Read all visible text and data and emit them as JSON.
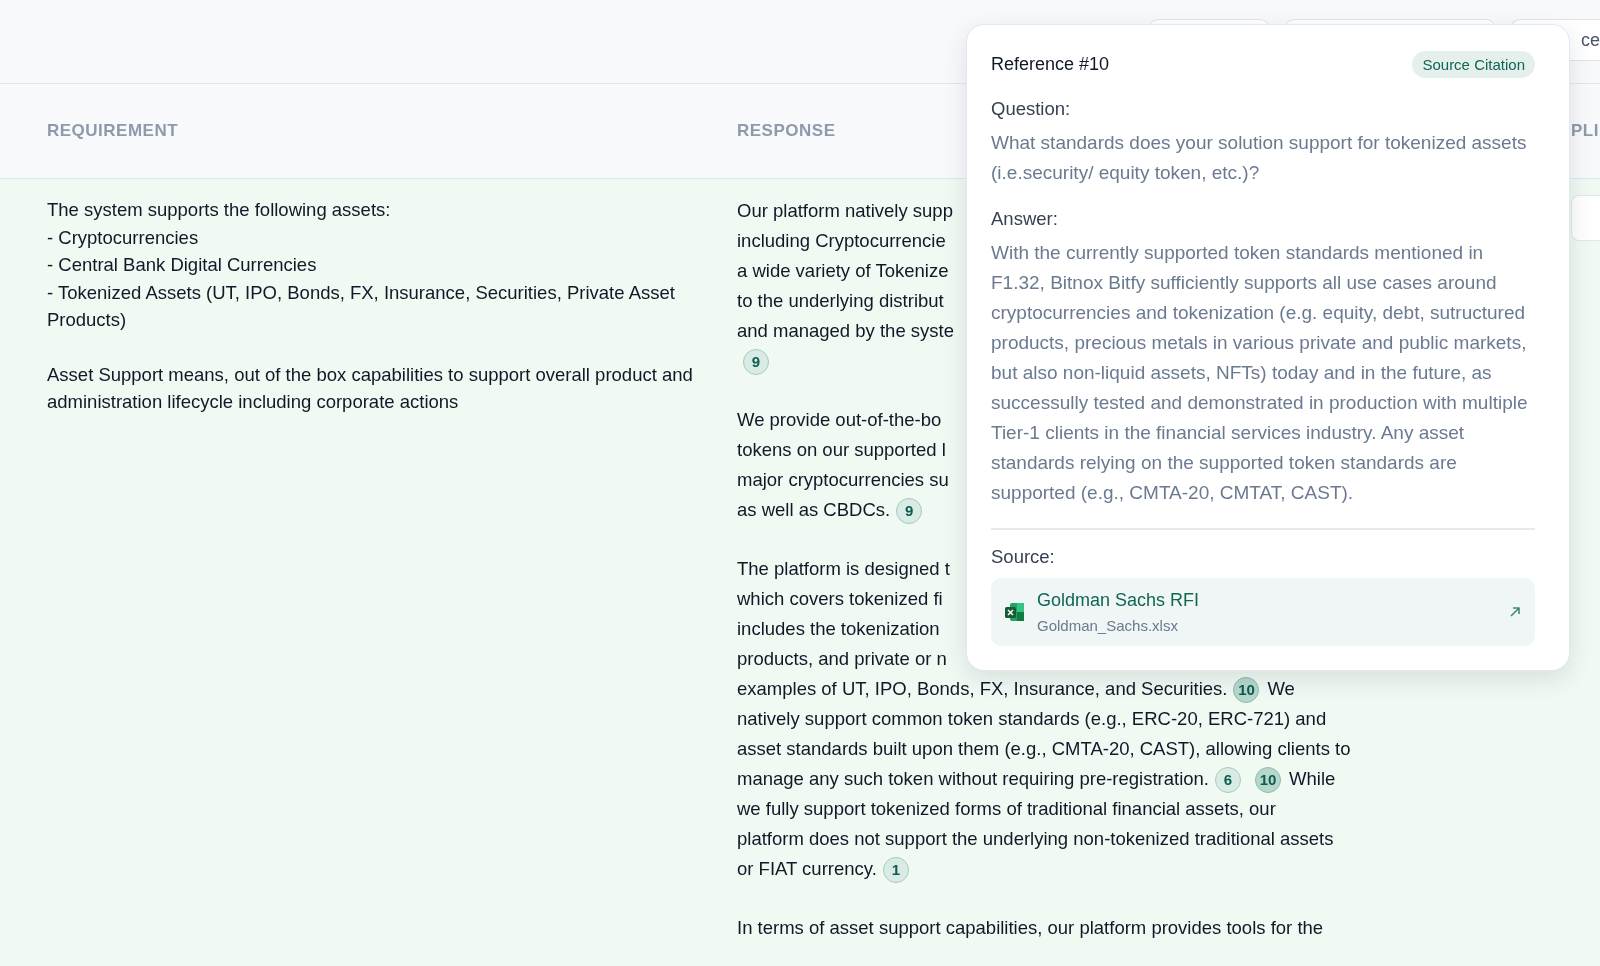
{
  "toolbar": [
    {
      "kind": "blank"
    },
    {
      "kind": "blank"
    },
    {
      "kind": "text",
      "label": "ce"
    }
  ],
  "table": {
    "columns": [
      "REQUIREMENT",
      "RESPONSE",
      "PLI"
    ],
    "row": {
      "requirement": [
        "The system supports the following assets:\n- Cryptocurrencies\n- Central Bank Digital Currencies\n- Tokenized Assets (UT, IPO, Bonds, FX, Insurance, Securities, Private Asset Products)",
        "Asset Support means, out of the box capabilities to support overall product and administration lifecycle including corporate actions"
      ],
      "response": [
        [
          [
            {
              "kind": "text",
              "text": "Our platform natively supp"
            }
          ],
          [
            {
              "kind": "text",
              "text": "including Cryptocurrencie"
            }
          ],
          [
            {
              "kind": "text",
              "text": "a wide variety of Tokenize"
            }
          ],
          [
            {
              "kind": "text",
              "text": "to the underlying distribut"
            }
          ],
          [
            {
              "kind": "text",
              "text": "and managed by the syste"
            }
          ],
          [
            {
              "kind": "citation",
              "text": "9",
              "selected": false
            }
          ]
        ],
        [
          [
            {
              "kind": "text",
              "text": "We provide out-of-the-bo"
            }
          ],
          [
            {
              "kind": "text",
              "text": "tokens on our supported l"
            }
          ],
          [
            {
              "kind": "text",
              "text": "major cryptocurrencies su"
            }
          ],
          [
            {
              "kind": "text",
              "text": "as well as CBDCs."
            },
            {
              "kind": "citation",
              "text": "9",
              "selected": false
            }
          ]
        ],
        [
          [
            {
              "kind": "text",
              "text": "The platform is designed t"
            }
          ],
          [
            {
              "kind": "text",
              "text": "which covers tokenized fi"
            }
          ],
          [
            {
              "kind": "text",
              "text": "includes the tokenization"
            }
          ],
          [
            {
              "kind": "text",
              "text": "products, and private or n"
            }
          ],
          [
            {
              "kind": "text",
              "text": "examples of UT, IPO, Bonds, FX, Insurance, and Securities."
            },
            {
              "kind": "citation",
              "text": "10",
              "selected": true
            },
            {
              "kind": "text",
              "text": "We"
            }
          ],
          [
            {
              "kind": "text",
              "text": "natively support common token standards (e.g., ERC-20, ERC-721) and"
            }
          ],
          [
            {
              "kind": "text",
              "text": "asset standards built upon them (e.g., CMTA-20, CAST), allowing clients to"
            }
          ],
          [
            {
              "kind": "text",
              "text": "manage any such token without requiring pre-registration."
            },
            {
              "kind": "citation",
              "text": "6",
              "selected": false
            },
            {
              "kind": "citation",
              "text": "10",
              "selected": true
            },
            {
              "kind": "text",
              "text": "While"
            }
          ],
          [
            {
              "kind": "text",
              "text": "we fully support tokenized forms of traditional financial assets, our"
            }
          ],
          [
            {
              "kind": "text",
              "text": "platform does not support the underlying non-tokenized traditional assets"
            }
          ],
          [
            {
              "kind": "text",
              "text": "or FIAT currency."
            },
            {
              "kind": "citation",
              "text": "1",
              "selected": false
            }
          ]
        ],
        [
          [
            {
              "kind": "text",
              "text": "In terms of asset support capabilities, our platform provides tools for the"
            }
          ]
        ]
      ]
    }
  },
  "popover": {
    "title": "Reference #10",
    "badge": "Source Citation",
    "question_label": "Question:",
    "question": "What standards does your solution support for tokenized assets (i.e.security/ equity token, etc.)?",
    "answer_label": "Answer:",
    "answer": "With the currently supported token standards mentioned in F1.32, Bitnox Bitfy sufficiently supports all use cases around cryptocurrencies and tokenization (e.g. equity, debt, sutructured products, precious metals in various private and public markets, but also non-liquid assets, NFTs) today and in the future, as successully tested and demonstrated in production with multiple Tier-1 clients in the financial services industry. Any asset standards relying on the supported token standards are supported (e.g., CMTA-20, CMTAT, CAST).",
    "source_label": "Source:",
    "source": {
      "title": "Goldman Sachs RFI",
      "file": "Goldman_Sachs.xlsx"
    }
  }
}
